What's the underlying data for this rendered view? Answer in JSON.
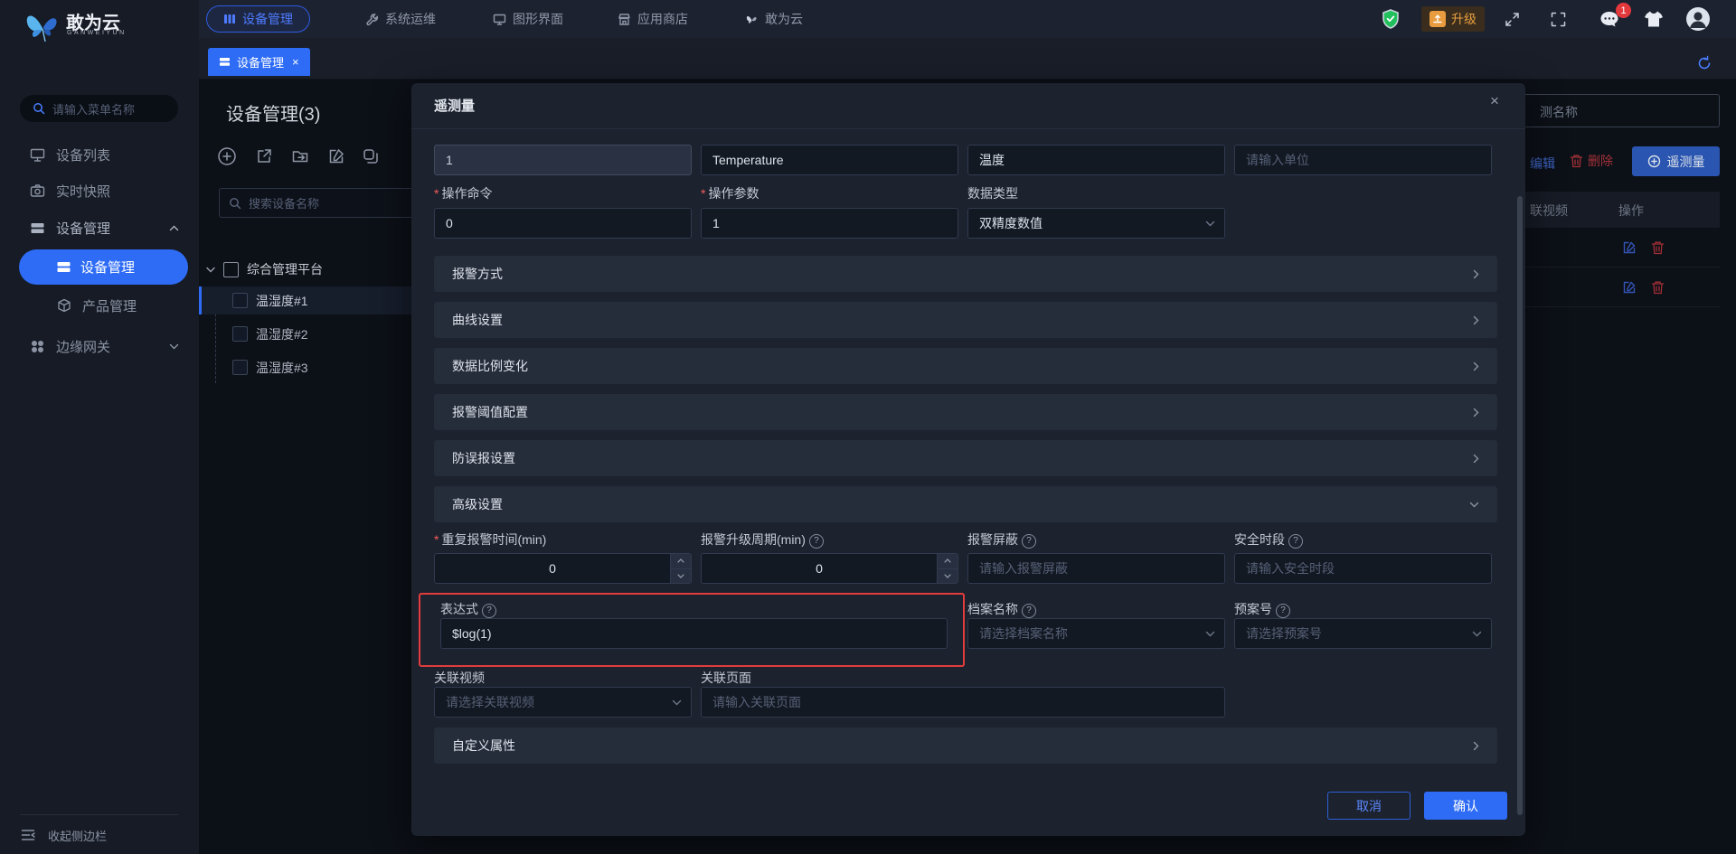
{
  "brand": {
    "name": "敢为云",
    "subtitle": "GANWEIYUN"
  },
  "topnav": {
    "items": [
      {
        "label": "设备管理",
        "active": true
      },
      {
        "label": "系统运维"
      },
      {
        "label": "图形界面"
      },
      {
        "label": "应用商店"
      },
      {
        "label": "敢为云"
      }
    ],
    "upgrade_label": "升级",
    "message_badge": "1"
  },
  "tabbar": {
    "active_tab": "设备管理",
    "close": "×"
  },
  "sidebar": {
    "search_placeholder": "请输入菜单名称",
    "items": [
      {
        "label": "设备列表"
      },
      {
        "label": "实时快照"
      },
      {
        "label": "设备管理",
        "expanded": true
      },
      {
        "label": "设备管理",
        "active": true,
        "child": true
      },
      {
        "label": "产品管理",
        "child": true
      },
      {
        "label": "边缘网关"
      }
    ],
    "collapse_label": "收起侧边栏"
  },
  "device_panel": {
    "title": "设备管理(3)",
    "search_placeholder": "搜索设备名称",
    "tree": {
      "root": "综合管理平台",
      "children": [
        {
          "label": "温湿度#1",
          "selected": true
        },
        {
          "label": "温湿度#2",
          "selected": false
        },
        {
          "label": "温湿度#3",
          "selected": false
        }
      ]
    }
  },
  "right_panel": {
    "search_text": "测名称",
    "edit_label": "编辑",
    "delete_label": "删除",
    "telemetry_button": "遥测量",
    "columns": {
      "video": "联视频",
      "action": "操作"
    }
  },
  "modal": {
    "title": "遥测量",
    "close": "×",
    "row1": [
      {
        "value": "1",
        "disabled": true
      },
      {
        "value": "Temperature"
      },
      {
        "value": "温度"
      },
      {
        "placeholder": "请输入单位"
      }
    ],
    "row2": {
      "cmd": {
        "label": "操作命令",
        "value": "0"
      },
      "param": {
        "label": "操作参数",
        "value": "1"
      },
      "dtype": {
        "label": "数据类型",
        "value": "双精度数值"
      }
    },
    "sections": [
      {
        "label": "报警方式",
        "expanded": false
      },
      {
        "label": "曲线设置",
        "expanded": false
      },
      {
        "label": "数据比例变化",
        "expanded": false
      },
      {
        "label": "报警阈值配置",
        "expanded": false
      },
      {
        "label": "防误报设置",
        "expanded": false
      },
      {
        "label": "高级设置",
        "expanded": true
      }
    ],
    "advanced": {
      "repeat": {
        "label": "重复报警时间(min)",
        "value": "0"
      },
      "cycle": {
        "label": "报警升级周期(min)",
        "value": "0"
      },
      "shield": {
        "label": "报警屏蔽",
        "placeholder": "请输入报警屏蔽"
      },
      "safe": {
        "label": "安全时段",
        "placeholder": "请输入安全时段"
      },
      "expression": {
        "label": "表达式",
        "value": "$log(1)",
        "highlighted": true
      },
      "archive": {
        "label": "档案名称",
        "placeholder": "请选择档案名称"
      },
      "plan": {
        "label": "预案号",
        "placeholder": "请选择预案号"
      },
      "video": {
        "label": "关联视频",
        "placeholder": "请选择关联视频"
      },
      "page": {
        "label": "关联页面",
        "placeholder": "请输入关联页面"
      }
    },
    "custom_section": {
      "label": "自定义属性"
    },
    "footer": {
      "cancel": "取消",
      "confirm": "确认"
    }
  },
  "colors": {
    "accent": "#2e6cf6",
    "danger": "#e04848",
    "warning": "#e89c3f",
    "success": "#21c05c",
    "highlight_border": "#e23c3c"
  }
}
